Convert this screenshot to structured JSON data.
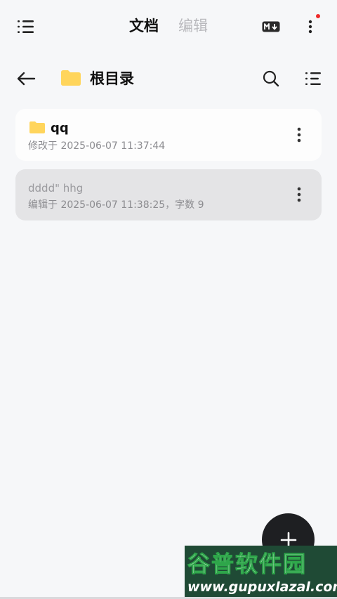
{
  "topbar": {
    "menu_icon": "list-menu-icon",
    "tab_docs": "文档",
    "tab_edit": "编辑",
    "markdown_icon": "markdown-icon",
    "more_icon": "more-vertical-icon",
    "notification_dot_color": "#ee2b2b"
  },
  "pathbar": {
    "back_icon": "arrow-left-icon",
    "folder_icon": "folder-icon",
    "title": "根目录",
    "search_icon": "search-icon",
    "sort_icon": "sort-list-icon"
  },
  "items": [
    {
      "type": "folder",
      "name": "qq",
      "meta": "修改于 2025-06-07 11:37:44"
    },
    {
      "type": "note",
      "title": "dddd\"  hhg",
      "meta": "编辑于 2025-06-07 11:38:25，字数 9"
    }
  ],
  "fab": {
    "icon": "plus-icon"
  },
  "watermark": {
    "top": "谷普软件园",
    "bottom": "www.gupuxlazal.com"
  },
  "colors": {
    "background": "#f6f7f9",
    "folder": "#ffd55c",
    "fab": "#1e1f22",
    "selected_card": "#e4e4e6"
  }
}
